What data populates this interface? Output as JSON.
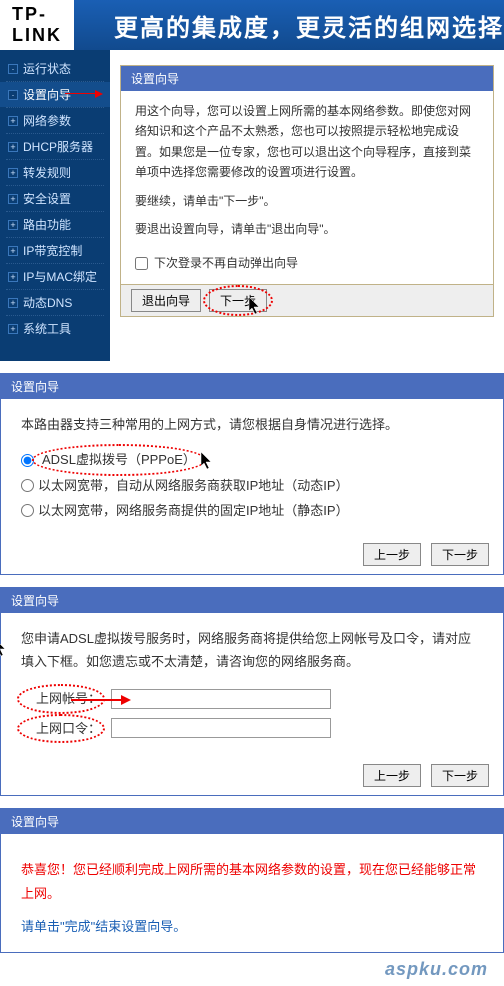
{
  "header": {
    "logo": "TP-LINK",
    "banner": "更高的集成度，更灵活的组网选择"
  },
  "sidebar": {
    "items": [
      {
        "label": "运行状态"
      },
      {
        "label": "设置向导"
      },
      {
        "label": "网络参数"
      },
      {
        "label": "DHCP服务器"
      },
      {
        "label": "转发规则"
      },
      {
        "label": "安全设置"
      },
      {
        "label": "路由功能"
      },
      {
        "label": "IP带宽控制"
      },
      {
        "label": "IP与MAC绑定"
      },
      {
        "label": "动态DNS"
      },
      {
        "label": "系统工具"
      }
    ]
  },
  "wizard": {
    "title": "设置向导",
    "intro": "用这个向导，您可以设置上网所需的基本网络参数。即使您对网络知识和这个产品不太熟悉，您也可以按照提示轻松地完成设置。如果您是一位专家，您也可以退出这个向导程序，直接到菜单项中选择您需要修改的设置项进行设置。",
    "continue_text": "要继续，请单击\"下一步\"。",
    "exit_text": "要退出设置向导，请单击\"退出向导\"。",
    "checkbox_label": "下次登录不再自动弹出向导",
    "btn_exit": "退出向导",
    "btn_next": "下一步"
  },
  "section1": {
    "title": "设置向导",
    "prompt": "本路由器支持三种常用的上网方式，请您根据自身情况进行选择。",
    "radios": [
      {
        "label": "ADSL虚拟拨号（PPPoE）"
      },
      {
        "label": "以太网宽带，自动从网络服务商获取IP地址（动态IP）"
      },
      {
        "label": "以太网宽带，网络服务商提供的固定IP地址（静态IP）"
      }
    ],
    "btn_prev": "上一步",
    "btn_next": "下一步"
  },
  "section2": {
    "title": "设置向导",
    "prompt": "您申请ADSL虚拟拨号服务时，网络服务商将提供给您上网帐号及口令，请对应填入下框。如您遗忘或不太清楚，请咨询您的网络服务商。",
    "field_account": "上网帐号：",
    "field_password": "上网口令：",
    "btn_prev": "上一步",
    "btn_next": "下一步"
  },
  "section3": {
    "title": "设置向导",
    "congrats": "恭喜您！您已经顺利完成上网所需的基本网络参数的设置，现在您已经能够正常上网。",
    "finish_text": "请单击\"完成\"结束设置向导。"
  },
  "watermark": "aspku.com"
}
